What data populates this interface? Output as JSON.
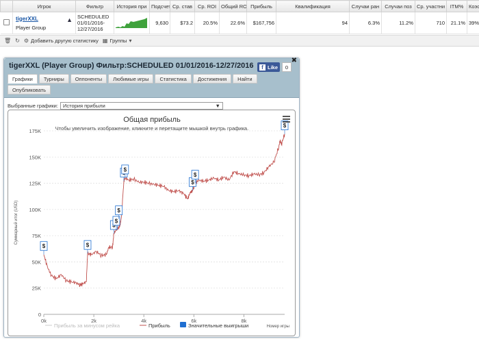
{
  "table": {
    "headers": [
      "Игрок",
      "Фильтр",
      "История при",
      "Подсчет",
      "Ср. став",
      "Ср. ROI",
      "Общий ROI",
      "Прибыль",
      "Квалификация",
      "Случаи ран",
      "Случаи поз",
      "Ср. участни",
      "ITM%",
      "Коэффиц"
    ],
    "row": {
      "player_name": "tigerXXL",
      "player_group": "Player Group",
      "filter_line1": "SCHEDULED",
      "filter_line2": "01/01/2016-",
      "filter_line3": "12/27/2016",
      "count": "9,630",
      "avg_stake": "$73.2",
      "avg_roi": "20.5%",
      "total_roi": "22.6%",
      "profit": "$167,756",
      "qualification": "94",
      "early": "6.3%",
      "late": "11.2%",
      "avg_entrants": "710",
      "itm": "21.1%",
      "coef": "39%"
    }
  },
  "toolbar": {
    "add_stat": "Добавить другую статистику",
    "groups": "Группы"
  },
  "dialog": {
    "title": "tigerXXL (Player Group) Фильтр:SCHEDULED 01/01/2016-12/27/2016",
    "like_label": "Like",
    "like_count": "0",
    "tabs": [
      "Графики",
      "Турниры",
      "Оппоненты",
      "Любимые игры",
      "Статистика",
      "Достижения",
      "Найти",
      "Опубликовать"
    ],
    "select_label": "Выбранные графики:",
    "select_value": "История прибыли"
  },
  "chart_data": {
    "type": "line",
    "title": "Общая прибыль",
    "subtitle": "Чтобы увеличить изображение, кликните и перетащите мышкой внутрь графика.",
    "xlabel": "Номер игры",
    "ylabel": "Суммарный итог (USD)",
    "xlim": [
      0,
      9630
    ],
    "ylim": [
      0,
      175000
    ],
    "x_ticks": [
      "0k",
      "2k",
      "4k",
      "6k",
      "8k"
    ],
    "y_ticks": [
      "0",
      "25K",
      "50K",
      "75K",
      "100K",
      "125K",
      "150K",
      "175K"
    ],
    "legend": [
      "Прибыль за минусом рейка",
      "Прибыль",
      "Значительные выигрыши"
    ],
    "legend_position": "bottom",
    "grid": true,
    "colors": {
      "profit": "#c0504d",
      "rake": "#cccccc",
      "wins": "#1f6fd1"
    },
    "series": [
      {
        "name": "Прибыль",
        "x": [
          0,
          150,
          300,
          500,
          700,
          900,
          1100,
          1300,
          1450,
          1550,
          1700,
          1750,
          1900,
          2100,
          2300,
          2500,
          2600,
          2750,
          2800,
          2900,
          3000,
          3050,
          3100,
          3200,
          3250,
          3400,
          3600,
          3800,
          4000,
          4200,
          4400,
          4600,
          4800,
          5000,
          5200,
          5400,
          5600,
          5750,
          5850,
          5950,
          6050,
          6200,
          6400,
          6600,
          6800,
          7000,
          7200,
          7400,
          7600,
          7800,
          8000,
          8200,
          8400,
          8600,
          8800,
          9000,
          9200,
          9400,
          9450,
          9500,
          9630
        ],
        "values": [
          57000,
          45000,
          37000,
          34000,
          38000,
          32000,
          31000,
          30000,
          28000,
          29000,
          31000,
          58000,
          57000,
          60000,
          56000,
          57000,
          64000,
          64000,
          77000,
          81000,
          83000,
          85000,
          92000,
          127000,
          130000,
          128000,
          129000,
          126000,
          126000,
          125000,
          124000,
          123000,
          122000,
          118000,
          117000,
          118000,
          115000,
          110000,
          116000,
          118000,
          125000,
          128000,
          127000,
          128000,
          130000,
          128000,
          131000,
          128000,
          136000,
          134000,
          133000,
          132000,
          134000,
          133000,
          135000,
          141000,
          145000,
          160000,
          166000,
          162000,
          172000
        ]
      }
    ],
    "big_wins": [
      {
        "x": 0,
        "y": 57000
      },
      {
        "x": 1750,
        "y": 58000
      },
      {
        "x": 2800,
        "y": 77000
      },
      {
        "x": 2900,
        "y": 81000
      },
      {
        "x": 3000,
        "y": 91000
      },
      {
        "x": 3200,
        "y": 127000
      },
      {
        "x": 3250,
        "y": 130000
      },
      {
        "x": 5950,
        "y": 118000
      },
      {
        "x": 6050,
        "y": 125000
      },
      {
        "x": 9630,
        "y": 172000
      }
    ],
    "big_win_label": "$"
  }
}
